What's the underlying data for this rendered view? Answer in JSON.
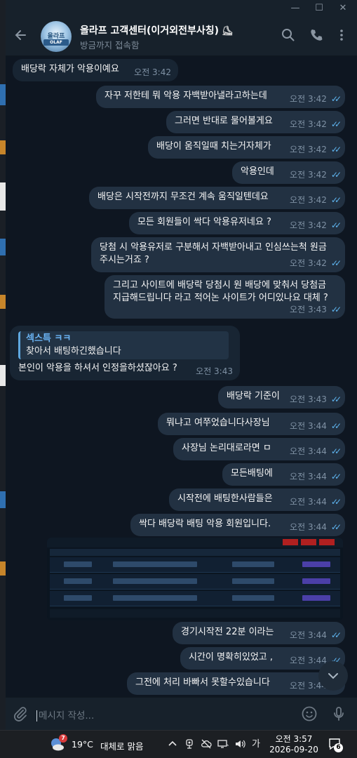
{
  "window": {
    "min": "—",
    "max": "☐",
    "close": "✕"
  },
  "header": {
    "title": "올라프 고객센터(이거외전부사칭)",
    "title_emoji": "⛸",
    "status": "방금까지 접속함",
    "avatar_band": "OLAF",
    "avatar_top": "올라프"
  },
  "messages": [
    {
      "dir": "in",
      "text": "배당락 자체가 악용이예요",
      "time": "오전 3:42"
    },
    {
      "dir": "out",
      "text": "자꾸 저한테 뭐 악용 자백받아낼라고하는데",
      "time": "오전 3:42"
    },
    {
      "dir": "out",
      "text": "그러면 반대로 물어볼게요",
      "time": "오전 3:42"
    },
    {
      "dir": "out",
      "text": "배당이 움직일때 치는거자체가",
      "time": "오전 3:42"
    },
    {
      "dir": "out",
      "text": "악용인데",
      "time": "오전 3:42"
    },
    {
      "dir": "out",
      "text": "배당은 시작전까지 무조건 계속 움직일텐데요",
      "time": "오전 3:42"
    },
    {
      "dir": "out",
      "text": "모든 회원들이 싹다 악용유저네요 ?",
      "time": "오전 3:42"
    },
    {
      "dir": "out",
      "text": "당첨 시 악용유저로 구분해서 자백받아내고 인심쓰는척 원금",
      "text2": "주시는거죠 ?",
      "time": "오전 3:42"
    },
    {
      "dir": "out",
      "text": "그리고 사이트에 배당락 당첨시 원 배당에 맞춰서 당첨금",
      "text2": "지급해드립니다 라고 적어논 사이트가 어디있나요 대체 ?",
      "time": "오전 3:43"
    },
    {
      "dir": "in",
      "reply_name": "섹스특 ㅋㅋ",
      "reply_text": "찾아서 배팅하긴했습니다",
      "text": "본인이 악용을 하셔서 인정을하셨잖아요 ?",
      "time": "오전 3:43"
    },
    {
      "dir": "out",
      "text": "배당락 기준이",
      "time": "오전 3:43"
    },
    {
      "dir": "out",
      "text": "뭐냐고 여쭈었습니다사장님",
      "time": "오전 3:44"
    },
    {
      "dir": "out",
      "text": "사장님 논리대로라면 ㅁ",
      "time": "오전 3:44"
    },
    {
      "dir": "out",
      "text": "모든배팅에",
      "time": "오전 3:44"
    },
    {
      "dir": "out",
      "text": "시작전에 배팅한사람들은",
      "time": "오전 3:44"
    },
    {
      "dir": "out",
      "text": "싹다 배당락 배팅 악용 회원입니다.",
      "time": "오전 3:44"
    },
    {
      "dir": "out",
      "text": "경기시작전 22분 이라는",
      "time": "오전 3:44"
    },
    {
      "dir": "out",
      "text": "시간이 명확히있었고 ,",
      "time": "오전 3:44"
    },
    {
      "dir": "out",
      "text": "그전에 처리 바빠서 못할수있습니다",
      "time": "오전 3:44"
    }
  ],
  "composer": {
    "placeholder": "메시지 작성..."
  },
  "taskbar": {
    "weather_badge": "7",
    "temp": "19°C",
    "weather_desc": "대체로 맑음",
    "ime": "가",
    "time": "오전 3:57",
    "date": "2026-09-20",
    "notif_count": "6"
  },
  "colors": {
    "chat_bg": "#0e1621",
    "bubble_in": "#182533",
    "bubble_out": "#223142",
    "header_bg": "#17212b",
    "check_blue": "#5fb5f0",
    "reply_accent": "#6ab3f3"
  }
}
